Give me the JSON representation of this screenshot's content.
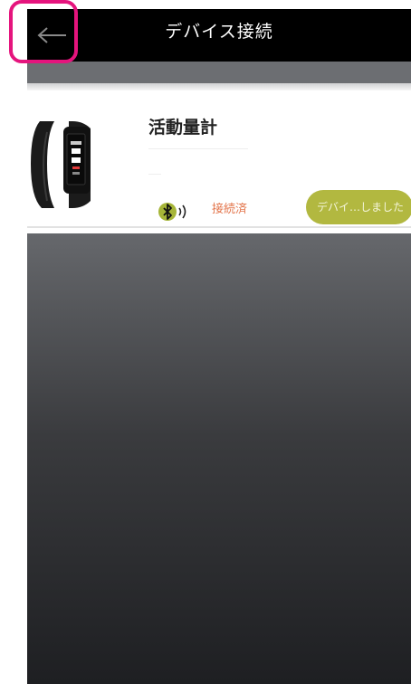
{
  "header": {
    "title": "デバイス接続",
    "back_icon": "arrow-left-icon"
  },
  "device": {
    "name": "活動量計",
    "image": "fitness-band-icon",
    "bluetooth_icon": "bluetooth-signal-icon",
    "status": "接続済",
    "disconnect_label": "デバイ…しました",
    "accent_color": "#b2b840",
    "status_color": "#e3744a"
  },
  "annotation": {
    "highlight_color": "#e5147d",
    "highlighted": "back-button"
  }
}
